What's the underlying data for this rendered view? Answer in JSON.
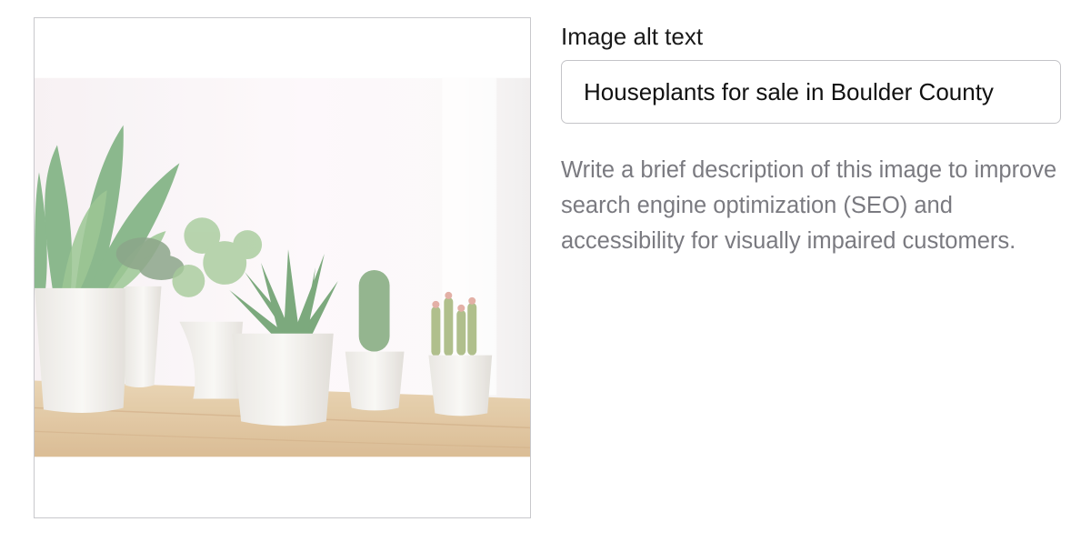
{
  "image_preview": {
    "subject": "potted succulents and cacti on a wooden shelf",
    "icon": "houseplants-photo"
  },
  "alt_text_field": {
    "label": "Image alt text",
    "value": "Houseplants for sale in Boulder County"
  },
  "help_text": "Write a brief description of this image to improve search engine optimization (SEO) and accessibility for visually impaired customers.",
  "colors": {
    "border": "#c4c4c8",
    "label_text": "#1a1a1a",
    "help_text": "#7a7a80",
    "shelf_wood": "#d8b98f",
    "plant_green": "#5f9a66"
  }
}
